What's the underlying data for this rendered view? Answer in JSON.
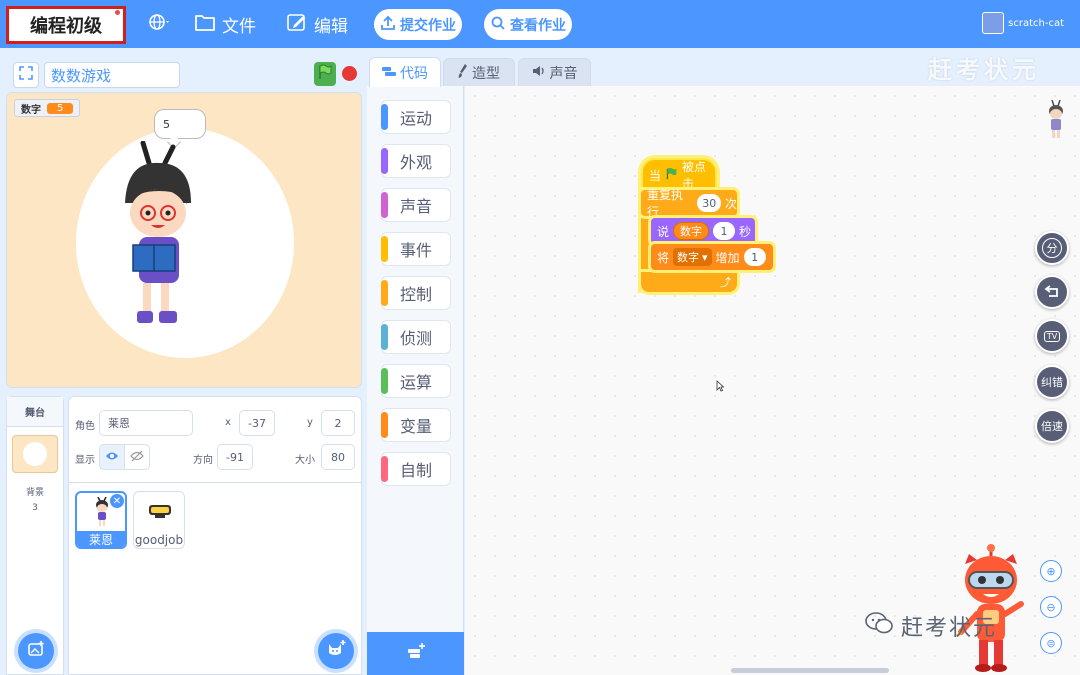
{
  "menubar": {
    "course_title": "编程初级",
    "file_label": "文件",
    "edit_label": "编辑",
    "submit_label": "提交作业",
    "view_label": "查看作业",
    "username": "scratch-cat",
    "watermark": "赶考状元"
  },
  "stage": {
    "project_title": "数数游戏",
    "variable_name": "数字",
    "variable_value": "5",
    "speech_text": "5"
  },
  "tabs": [
    {
      "label": "代码"
    },
    {
      "label": "造型"
    },
    {
      "label": "声音"
    }
  ],
  "categories": [
    {
      "label": "运动",
      "color": "#4c97ff"
    },
    {
      "label": "外观",
      "color": "#9966ff"
    },
    {
      "label": "声音",
      "color": "#cf63cf"
    },
    {
      "label": "事件",
      "color": "#ffbf00"
    },
    {
      "label": "控制",
      "color": "#ffab19"
    },
    {
      "label": "侦测",
      "color": "#5cb1d6"
    },
    {
      "label": "运算",
      "color": "#59c059"
    },
    {
      "label": "变量",
      "color": "#ff8c1a"
    },
    {
      "label": "自制",
      "color": "#ff6680"
    }
  ],
  "sprite_info": {
    "sprite_label": "角色",
    "sprite_name": "莱恩",
    "x_label": "x",
    "x_value": "-37",
    "y_label": "y",
    "y_value": "2",
    "show_label": "显示",
    "direction_label": "方向",
    "direction_value": "-91",
    "size_label": "大小",
    "size_value": "80"
  },
  "sprites": [
    {
      "name": "莱恩",
      "selected": true
    },
    {
      "name": "goodjob",
      "selected": false
    }
  ],
  "backdrop": {
    "tab_label": "舞台",
    "backdrop_label": "背景",
    "backdrop_count": "3"
  },
  "script": {
    "when_prefix": "当",
    "when_suffix": "被点击",
    "repeat_label": "重复执行",
    "repeat_count": "30",
    "repeat_unit": "次",
    "say_label": "说",
    "say_variable": "数字",
    "say_seconds": "1",
    "say_unit": "秒",
    "change_label": "将",
    "change_variable": "数字",
    "change_by_label": "增加",
    "change_amount": "1"
  },
  "side_controls": {
    "split_label": "分",
    "tv_label": "TV",
    "fix_label": "纠错",
    "speed_label": "倍速"
  },
  "watermark_bottom": "赶考状元"
}
